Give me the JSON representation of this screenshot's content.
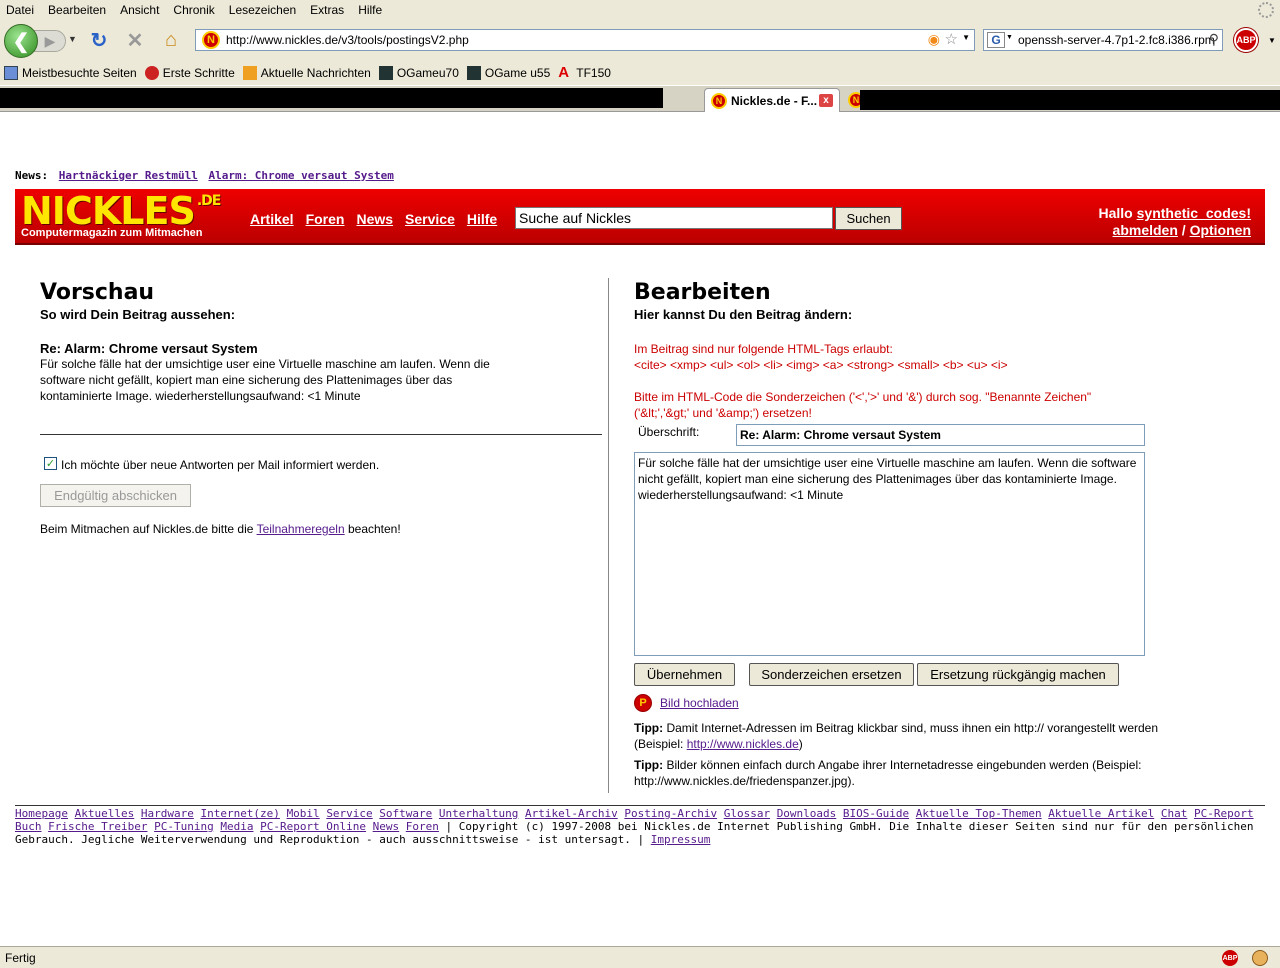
{
  "browser": {
    "menu": [
      "Datei",
      "Bearbeiten",
      "Ansicht",
      "Chronik",
      "Lesezeichen",
      "Extras",
      "Hilfe"
    ],
    "url": "http://www.nickles.de/v3/tools/postingsV2.php",
    "search_value": "openssh-server-4.7p1-2.fc8.i386.rpm",
    "abp_label": "ABP",
    "bookmarks": [
      "Meistbesuchte Seiten",
      "Erste Schritte",
      "Aktuelle Nachrichten",
      "OGameu70",
      "OGame u55",
      "TF150"
    ],
    "active_tab": "Nickles.de - F...",
    "tab_close": "x",
    "status": "Fertig"
  },
  "news": {
    "label": "News:",
    "items": [
      "Hartnäckiger Restmüll",
      "Alarm: Chrome versaut System"
    ]
  },
  "header": {
    "logo": "NICKLES",
    "logo_suffix": ".DE",
    "tagline": "Computermagazin zum Mitmachen",
    "nav": [
      "Artikel",
      "Foren",
      "News",
      "Service",
      "Hilfe"
    ],
    "search_value": "Suche auf Nickles",
    "search_button": "Suchen",
    "hello_prefix": "Hallo",
    "username": "synthetic_codes!",
    "logout": "abmelden",
    "sep": "/",
    "options": "Optionen"
  },
  "preview": {
    "heading": "Vorschau",
    "subheading": "So wird Dein Beitrag aussehen:",
    "post_title": "Re: Alarm: Chrome versaut System",
    "post_body": "Für solche fälle hat der umsichtige user eine Virtuelle maschine am laufen. Wenn die software nicht gefällt, kopiert man eine sicherung des Plattenimages über das kontaminierte Image. wiederherstellungsaufwand: <1 Minute",
    "checkbox_label": "Ich möchte über neue Antworten per Mail informiert werden.",
    "checkbox_mark": "✓",
    "submit_button": "Endgültig abschicken",
    "rules_prefix": "Beim Mitmachen auf Nickles.de bitte die",
    "rules_link": "Teilnahmeregeln",
    "rules_suffix": "beachten!"
  },
  "edit": {
    "heading": "Bearbeiten",
    "subheading": "Hier kannst Du den Beitrag ändern:",
    "allowed_tags_label": "Im Beitrag sind nur folgende HTML-Tags erlaubt:",
    "allowed_tags": "<cite> <xmp> <ul> <ol> <li> <img> <a> <strong> <small> <b> <u> <i>",
    "entities_note": "Bitte im HTML-Code die Sonderzeichen ('<','>' und '&') durch sog. \"Benannte Zeichen\" ('&lt;','&gt;' und '&amp;') ersetzen!",
    "title_label": "Überschrift:",
    "title_value": "Re: Alarm: Chrome versaut System",
    "body_value": "Für solche fälle hat der umsichtige user eine Virtuelle maschine am laufen. Wenn die software nicht gefällt, kopiert man eine sicherung des Plattenimages über das kontaminierte Image. wiederherstellungsaufwand: <1 Minute",
    "buttons": [
      "Übernehmen",
      "Sonderzeichen ersetzen",
      "Ersetzung rückgängig machen"
    ],
    "upload_link": "Bild hochladen",
    "tip1_label": "Tipp:",
    "tip1_text": "Damit Internet-Adressen im Beitrag klickbar sind, muss ihnen ein http:// vorangestellt werden (Beispiel:",
    "tip1_link": "http://www.nickles.de",
    "tip1_end": ")",
    "tip2_label": "Tipp:",
    "tip2_text": "Bilder können einfach durch Angabe ihrer Internetadresse eingebunden werden (Beispiel: http://www.nickles.de/friedenspanzer.jpg)."
  },
  "footer": {
    "links": [
      "Homepage",
      "Aktuelles",
      "Hardware",
      "Internet(ze)",
      "Mobil",
      "Service",
      "Software",
      "Unterhaltung",
      "Artikel-Archiv",
      "Posting-Archiv",
      "Glossar",
      "Downloads",
      "BIOS-Guide",
      "Aktuelle Top-Themen",
      "Aktuelle Artikel",
      "Chat",
      "PC-Report Buch",
      "Frische Treiber",
      "PC-Tuning",
      "Media",
      "PC-Report Online",
      "News",
      "Foren"
    ],
    "copyright": "| Copyright (c) 1997-2008 bei Nickles.de Internet Publishing GmbH. Die Inhalte dieser Seiten sind nur für den persönlichen Gebrauch. Jegliche Weiterverwendung und Reproduktion - auch ausschnittsweise - ist untersagt. |",
    "impressum": "Impressum"
  }
}
